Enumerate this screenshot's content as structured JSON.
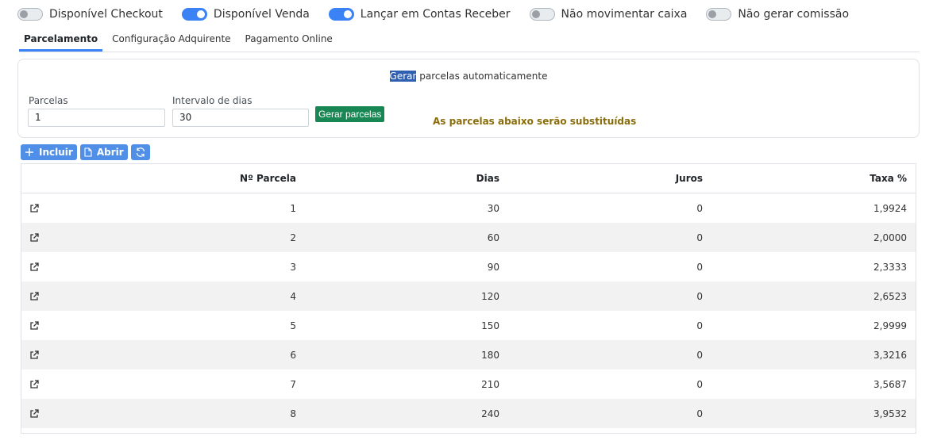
{
  "toggles": [
    {
      "label": "Disponível Checkout",
      "on": false
    },
    {
      "label": "Disponível Venda",
      "on": true
    },
    {
      "label": "Lançar em Contas Receber",
      "on": true
    },
    {
      "label": "Não movimentar caixa",
      "on": false
    },
    {
      "label": "Não gerar comissão",
      "on": false
    }
  ],
  "tabs": [
    {
      "label": "Parcelamento",
      "active": true
    },
    {
      "label": "Configuração Adquirente",
      "active": false
    },
    {
      "label": "Pagamento Online",
      "active": false
    }
  ],
  "generator": {
    "title_highlight": "Gerar",
    "title_rest": " parcelas automaticamente",
    "parcelas_label": "Parcelas",
    "parcelas_value": "1",
    "intervalo_label": "Intervalo de dias",
    "intervalo_value": "30",
    "button_label": "Gerar parcelas",
    "warning": "As parcelas abaixo serão substituídas"
  },
  "toolbar": {
    "incluir_label": "Incluir",
    "abrir_label": "Abrir",
    "refresh_icon": "refresh-icon"
  },
  "colors": {
    "accent": "#3b82f6",
    "toolbar_button": "#4f8fe8",
    "success": "#198754",
    "warning_text": "#8a6d0b"
  },
  "table": {
    "headers": {
      "numero": "Nº Parcela",
      "dias": "Dias",
      "juros": "Juros",
      "taxa": "Taxa %"
    },
    "row_icon": "external-link-icon",
    "rows": [
      {
        "numero": "1",
        "dias": "30",
        "juros": "0",
        "taxa": "1,9924"
      },
      {
        "numero": "2",
        "dias": "60",
        "juros": "0",
        "taxa": "2,0000"
      },
      {
        "numero": "3",
        "dias": "90",
        "juros": "0",
        "taxa": "2,3333"
      },
      {
        "numero": "4",
        "dias": "120",
        "juros": "0",
        "taxa": "2,6523"
      },
      {
        "numero": "5",
        "dias": "150",
        "juros": "0",
        "taxa": "2,9999"
      },
      {
        "numero": "6",
        "dias": "180",
        "juros": "0",
        "taxa": "3,3216"
      },
      {
        "numero": "7",
        "dias": "210",
        "juros": "0",
        "taxa": "3,5687"
      },
      {
        "numero": "8",
        "dias": "240",
        "juros": "0",
        "taxa": "3,9532"
      }
    ]
  }
}
